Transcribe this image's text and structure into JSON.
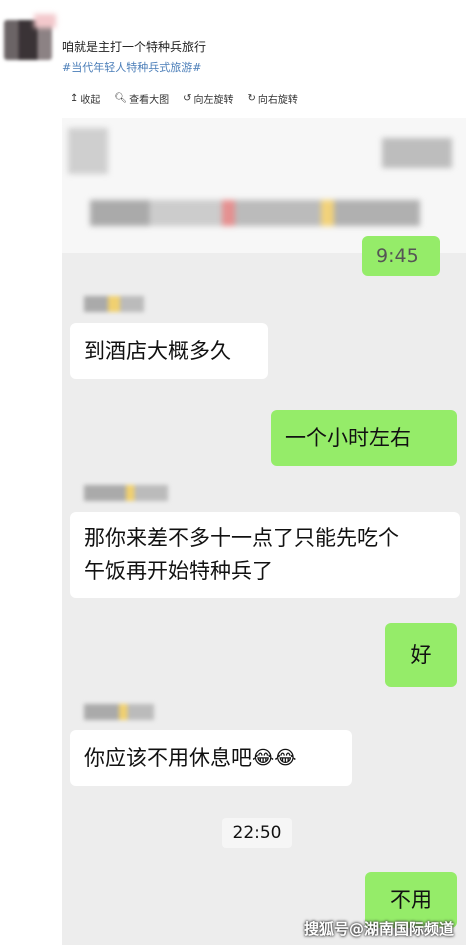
{
  "post": {
    "text": "咱就是主打一个特种兵旅行",
    "tag": "#当代年轻人特种兵式旅游#"
  },
  "toolbar": {
    "collapse": "收起",
    "view_large": "查看大图",
    "rotate_left": "向左旋转",
    "rotate_right": "向右旋转"
  },
  "chat": {
    "partial_time": "9:45",
    "messages": [
      {
        "side": "left",
        "text": "到酒店大概多久"
      },
      {
        "side": "right",
        "text": "一个小时左右"
      },
      {
        "side": "left",
        "text_line1": "那你来差不多十一点了只能先吃个",
        "text_line2": "午饭再开始特种兵了"
      },
      {
        "side": "right",
        "text": "好"
      },
      {
        "side": "left",
        "text": "你应该不用休息吧",
        "emoji": "😂😂"
      },
      {
        "side": "right",
        "text": "不用"
      }
    ],
    "time_divider": "22:50"
  },
  "watermark": "搜狐号@湖南国际频道",
  "colors": {
    "sent": "#95ec69",
    "received": "#ffffff",
    "chat_bg": "#ededed",
    "tag": "#4a7db8"
  }
}
